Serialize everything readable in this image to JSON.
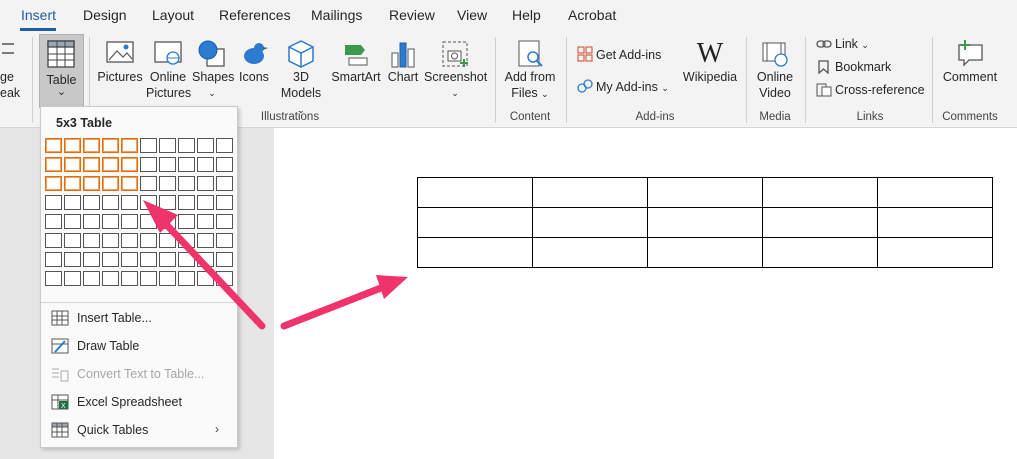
{
  "tabs": [
    "Insert",
    "Design",
    "Layout",
    "References",
    "Mailings",
    "Review",
    "View",
    "Help",
    "Acrobat"
  ],
  "ribbon": {
    "cut_label_1": "ge",
    "cut_label_2": "eak",
    "table": {
      "label": "Table",
      "chevron": "⌄"
    },
    "pictures": "Pictures",
    "online_pictures_1": "Online",
    "online_pictures_2": "Pictures",
    "shapes": "Shapes",
    "icons": "Icons",
    "models_1": "3D",
    "models_2": "Models",
    "smartart": "SmartArt",
    "chart": "Chart",
    "screenshot": "Screenshot",
    "add_from_files_1": "Add from",
    "add_from_files_2": "Files",
    "get_addins": "Get Add-ins",
    "my_addins": "My Add-ins",
    "wikipedia": "Wikipedia",
    "online_video_1": "Online",
    "online_video_2": "Video",
    "link": "Link",
    "bookmark": "Bookmark",
    "cross_reference": "Cross-reference",
    "comment": "Comment",
    "groups": {
      "illustrations": "Illustrations",
      "content": "Content",
      "addins": "Add-ins",
      "media": "Media",
      "links": "Links",
      "comments": "Comments"
    }
  },
  "dropdown": {
    "title": "5x3 Table",
    "grid_columns": 10,
    "grid_rows": 8,
    "selected_columns": 5,
    "selected_rows": 3,
    "items": [
      {
        "label": "Insert Table...",
        "enabled": true,
        "icon": "table-icon"
      },
      {
        "label": "Draw Table",
        "enabled": true,
        "icon": "pencil-table-icon"
      },
      {
        "label": "Convert Text to Table...",
        "enabled": false,
        "icon": "convert-icon"
      },
      {
        "label": "Excel Spreadsheet",
        "enabled": true,
        "icon": "excel-icon"
      },
      {
        "label": "Quick Tables",
        "enabled": true,
        "icon": "quick-tables-icon",
        "submenu": true
      }
    ]
  },
  "document_table": {
    "rows": 3,
    "columns": 5
  },
  "colors": {
    "accent": "#1f5ca8",
    "selection": "#e46c0a",
    "arrow": "#f0336a"
  }
}
